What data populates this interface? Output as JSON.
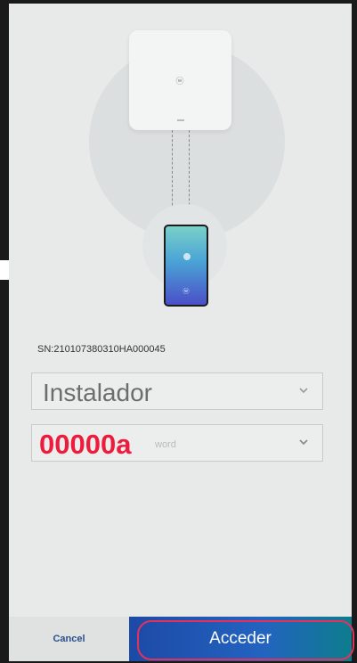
{
  "device": {
    "logo": "ⓦ",
    "phone_logo": "ⓦ"
  },
  "serial": {
    "text": "SN:210107380310HA000045"
  },
  "login": {
    "user_value": "Instalador",
    "password_value": "00000a",
    "password_placeholder": "word"
  },
  "actions": {
    "cancel_label": "Cancel",
    "accept_label": "Acceder"
  },
  "colors": {
    "accent_red": "#ee1c3c",
    "accent_blue": "#1c4aa6",
    "cancel_text": "#2c4f8b"
  },
  "icons": {
    "user_dropdown": "chevron-down-icon",
    "password_dropdown": "chevron-down-icon"
  }
}
